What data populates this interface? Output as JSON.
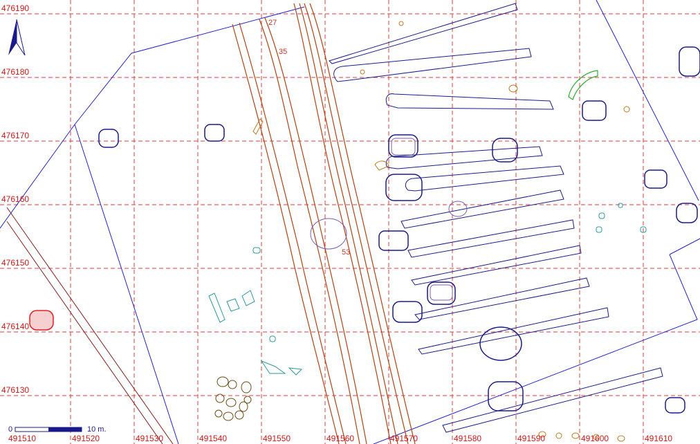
{
  "map": {
    "x_labels": [
      "491510",
      "491520",
      "491530",
      "491540",
      "491550",
      "491560",
      "491570",
      "491580",
      "491590",
      "491600",
      "491610"
    ],
    "y_labels": [
      "476190",
      "476180",
      "476170",
      "476160",
      "476150",
      "476140",
      "476130"
    ],
    "feature_labels": [
      "27",
      "35",
      "53"
    ],
    "scale": {
      "start": "0",
      "end": "10  m."
    },
    "north_arrow": "north-arrow-icon",
    "colors": {
      "grid": "#e23b3b",
      "boundary": "#2222cc",
      "ditch": "#b5410f",
      "feature_blue": "#1a1a8c",
      "feature_purple": "#7a5fb5",
      "feature_teal": "#2a9a9a",
      "feature_orange": "#c07a20",
      "feature_red": "#e02020",
      "feature_green": "#2fae2f"
    }
  }
}
